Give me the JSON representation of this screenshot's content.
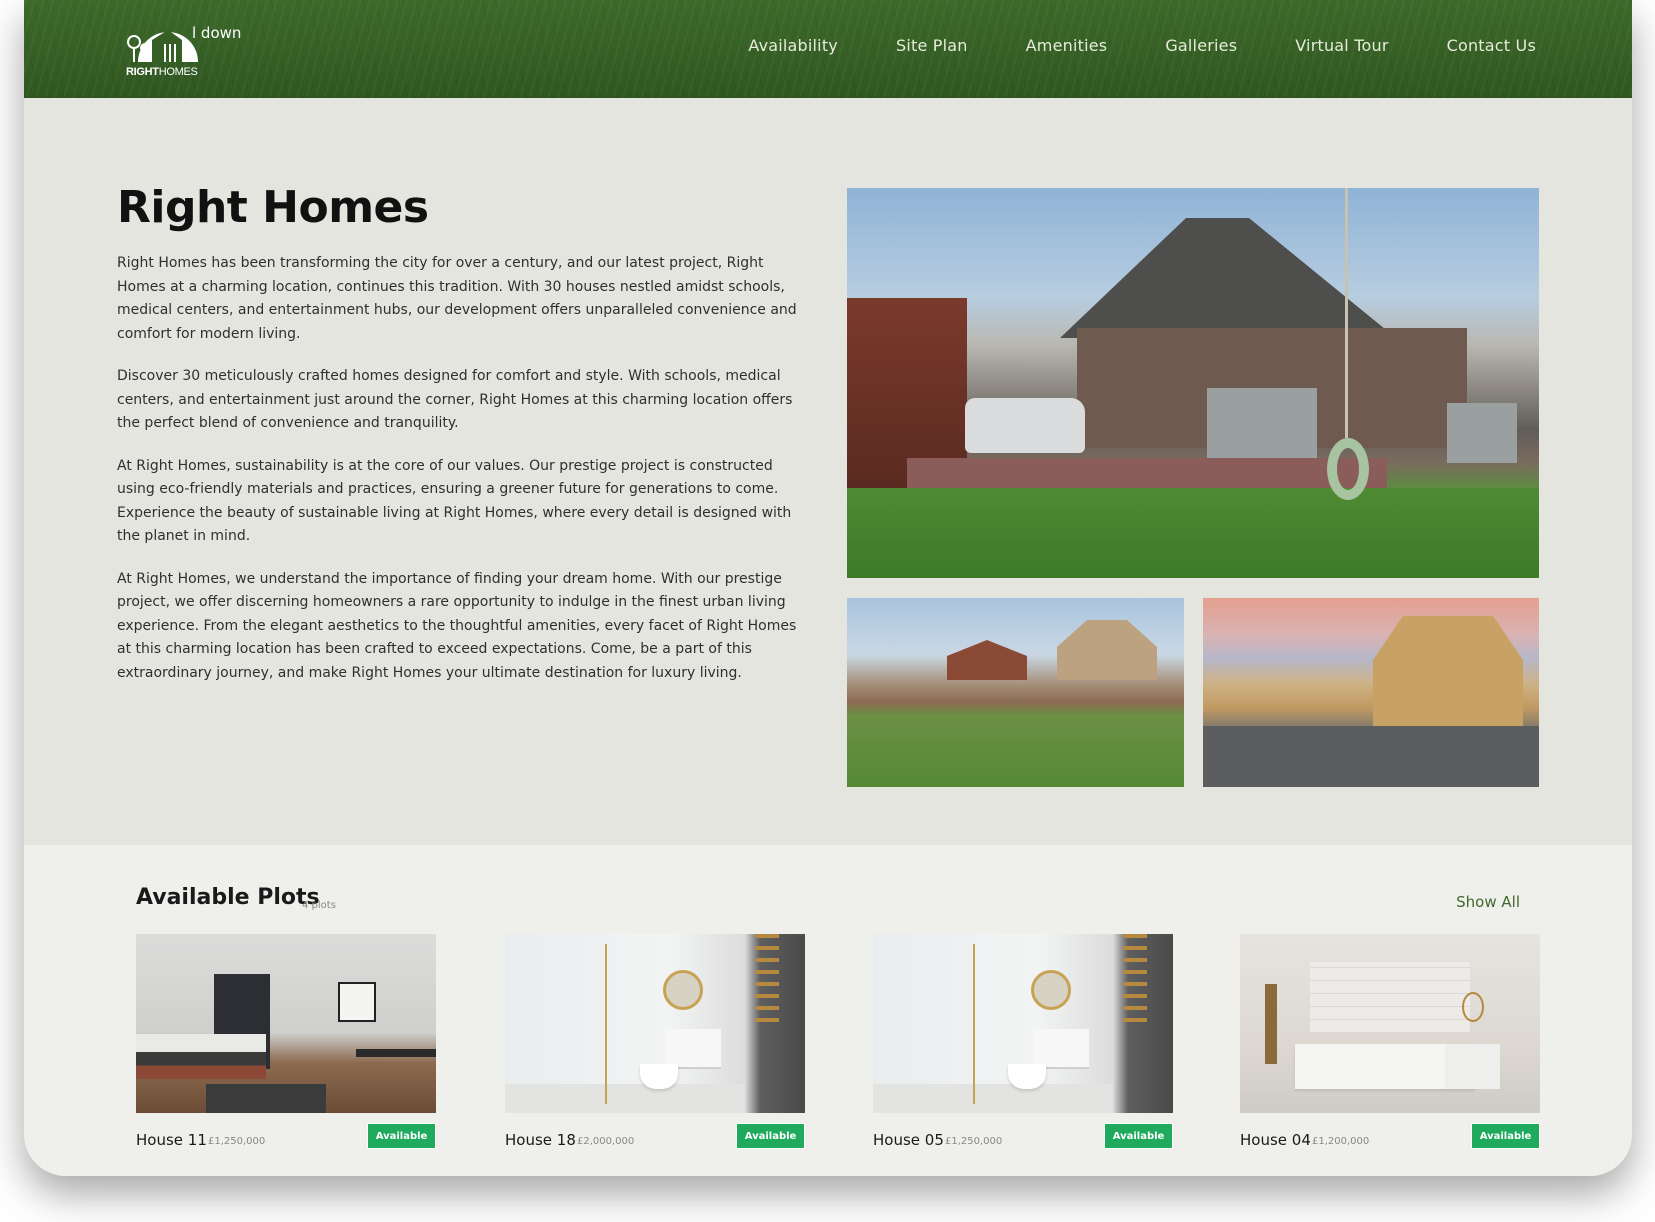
{
  "header": {
    "logo_text_bold": "RIGHT",
    "logo_text_light": "HOMES",
    "scroll_hint": "l down",
    "nav": [
      {
        "label": "Availability"
      },
      {
        "label": "Site Plan"
      },
      {
        "label": "Amenities"
      },
      {
        "label": "Galleries"
      },
      {
        "label": "Virtual Tour"
      },
      {
        "label": "Contact Us"
      }
    ]
  },
  "intro": {
    "title": "Right Homes",
    "paragraphs": [
      "Right Homes has been transforming the city for over a century, and our latest project, Right Homes at a charming location, continues this tradition. With 30 houses nestled amidst schools, medical centers, and entertainment hubs, our development offers unparalleled convenience and comfort for modern living.",
      "Discover 30 meticulously crafted homes designed for comfort and style. With schools, medical centers, and entertainment just around the corner, Right Homes at this charming location offers the perfect blend of convenience and tranquility.",
      "At Right Homes, sustainability is at the core of our values. Our prestige project is constructed using eco-friendly materials and practices, ensuring a greener future for generations to come. Experience the beauty of sustainable living at Right Homes, where every detail is designed with the planet in mind.",
      "At Right Homes, we understand the importance of finding your dream home. With our prestige project, we offer discerning homeowners a rare opportunity to indulge in the finest urban living experience. From the elegant aesthetics to the thoughtful amenities, every facet of Right Homes at this charming location has been crafted to exceed expectations. Come, be a part of this extraordinary journey, and make Right Homes your ultimate destination for luxury living."
    ]
  },
  "plots": {
    "title": "Available Plots",
    "count": "4 plots",
    "show_all": "Show All",
    "items": [
      {
        "name": "House 11",
        "price": "£1,250,000",
        "status": "Available"
      },
      {
        "name": "House 18",
        "price": "£2,000,000",
        "status": "Available"
      },
      {
        "name": "House 05",
        "price": "£1,250,000",
        "status": "Available"
      },
      {
        "name": "House 04",
        "price": "£1,200,000",
        "status": "Available"
      }
    ]
  },
  "colors": {
    "header_green": "#365f25",
    "badge_green": "#1faa5e",
    "link_green": "#3f6a2c"
  }
}
